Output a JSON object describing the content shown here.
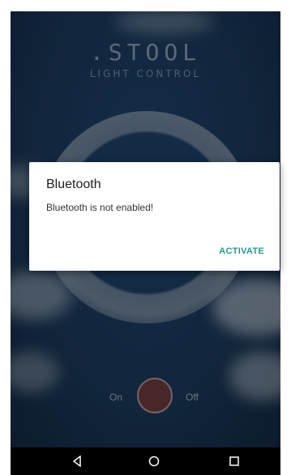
{
  "app": {
    "logo_text": ".STOOL",
    "subtitle": "LIGHT CONTROL"
  },
  "toggle": {
    "on_label": "On",
    "off_label": "Off",
    "button_icon": "power-toggle-circle"
  },
  "dialog": {
    "title": "Bluetooth",
    "message": "Bluetooth is not enabled!",
    "action_label": "ACTIVATE"
  },
  "navbar": {
    "back_icon": "back-triangle-icon",
    "home_icon": "home-circle-icon",
    "recents_icon": "recents-square-icon"
  },
  "colors": {
    "accent": "#1f9e93",
    "background": "#1c3b5e",
    "power_button": "#6e3c3c"
  }
}
